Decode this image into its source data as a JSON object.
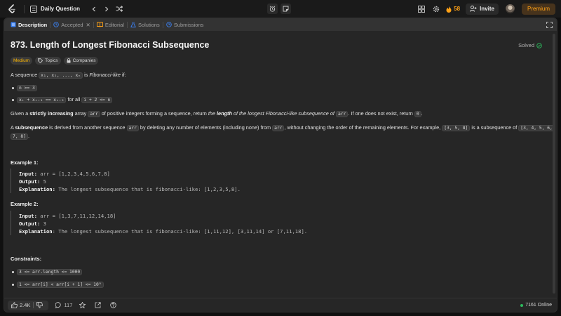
{
  "topbar": {
    "title": "Daily Question",
    "streak": "58",
    "invite_label": "Invite",
    "premium_label": "Premium"
  },
  "tabs": [
    {
      "label": "Description"
    },
    {
      "label": "Accepted"
    },
    {
      "label": "Editorial"
    },
    {
      "label": "Solutions"
    },
    {
      "label": "Submissions"
    }
  ],
  "problem": {
    "title": "873. Length of Longest Fibonacci Subsequence",
    "status": "Solved",
    "difficulty": "Medium",
    "topics_label": "Topics",
    "companies_label": "Companies",
    "intro_a": "A sequence ",
    "intro_seq": "x₁, x₂, ..., xₙ",
    "intro_b": " is ",
    "intro_fib": "Fibonacci-like",
    "intro_c": " if:",
    "cond1": "n >= 3",
    "cond2_code": "xᵢ + xᵢ₊₁ == xᵢ₊₂",
    "cond2_text": " for all ",
    "cond2_code2": "i + 2 <= n",
    "given_a": "Given a ",
    "given_b": "strictly increasing",
    "given_c": " array ",
    "given_arr": "arr",
    "given_d": " of positive integers forming a sequence, return ",
    "given_e": "the ",
    "given_f": "length",
    "given_g": " of the longest Fibonacci-like subsequence of",
    "given_h": ". If one does not exist, return ",
    "given_zero": "0",
    "given_i": ".",
    "sub_a": "A ",
    "sub_b": "subsequence",
    "sub_c": " is derived from another sequence ",
    "sub_d": " by deleting any number of elements (including none) from ",
    "sub_e": ", without changing the order of the remaining elements. For example, ",
    "sub_ex1": "[3, 5, 8]",
    "sub_f": " is a subsequence of ",
    "sub_ex2a": "[3, 4, 5, 6,",
    "sub_ex2b": "7, 8]",
    "sub_g": "."
  },
  "examples": [
    {
      "heading": "Example 1:",
      "input_k": "Input:",
      "input": " arr = [1,2,3,4,5,6,7,8]",
      "output_k": "Output:",
      "output": " 5",
      "expl_k": "Explanation:",
      "expl": " The longest subsequence that is fibonacci-like: [1,2,3,5,8]."
    },
    {
      "heading": "Example 2:",
      "input_k": "Input:",
      "input": " arr = [1,3,7,11,12,14,18]",
      "output_k": "Output:",
      "output": " 3",
      "expl_k": "Explanation",
      "expl": ": The longest subsequence that is fibonacci-like: [1,11,12], [3,11,14] or [7,11,18]."
    }
  ],
  "constraints": {
    "heading": "Constraints:",
    "c1": "3 <= arr.length <= 1000",
    "c2": "1 <= arr[i] < arr[i + 1] <= 10⁹"
  },
  "footer": {
    "likes": "2.4K",
    "comments": "117",
    "online": "7161 Online"
  },
  "colors": {
    "accent": "#ffa116",
    "medium": "#ffb800",
    "solved": "#2cbb5d",
    "tab_blue": "#3b82f6"
  }
}
